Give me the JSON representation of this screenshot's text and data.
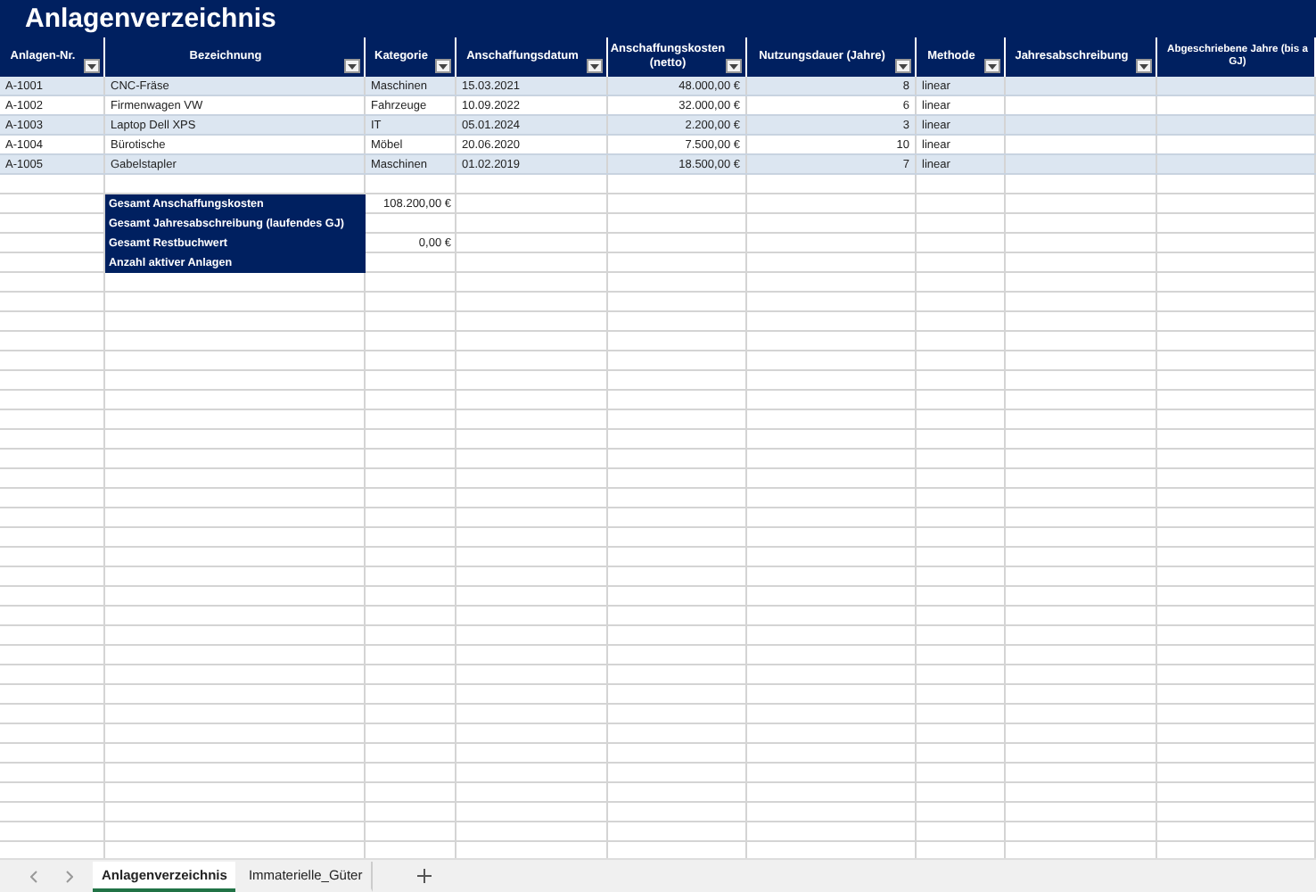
{
  "title": "Anlagenverzeichnis",
  "columns": [
    {
      "label": "Anlagen-Nr.",
      "filter": true
    },
    {
      "label": "Bezeichnung",
      "filter": true
    },
    {
      "label": "Kategorie",
      "filter": true
    },
    {
      "label": "Anschaffungsdatum",
      "filter": true
    },
    {
      "label": "Anschaffungskosten (netto)",
      "filter": true
    },
    {
      "label": "Nutzungsdauer (Jahre)",
      "filter": true
    },
    {
      "label": "Methode",
      "filter": true
    },
    {
      "label": "Jahresabschreibung",
      "filter": true
    },
    {
      "label": "Abgeschriebene Jahre (bis a\nGJ)",
      "filter": false
    }
  ],
  "rows": [
    {
      "id": "A-1001",
      "name": "CNC-Fräse",
      "category": "Maschinen",
      "date": "15.03.2021",
      "cost": "48.000,00 €",
      "life": "8",
      "method": "linear"
    },
    {
      "id": "A-1002",
      "name": "Firmenwagen VW",
      "category": "Fahrzeuge",
      "date": "10.09.2022",
      "cost": "32.000,00 €",
      "life": "6",
      "method": "linear"
    },
    {
      "id": "A-1003",
      "name": "Laptop Dell XPS",
      "category": "IT",
      "date": "05.01.2024",
      "cost": "2.200,00 €",
      "life": "3",
      "method": "linear"
    },
    {
      "id": "A-1004",
      "name": "Bürotische",
      "category": "Möbel",
      "date": "20.06.2020",
      "cost": "7.500,00 €",
      "life": "10",
      "method": "linear"
    },
    {
      "id": "A-1005",
      "name": "Gabelstapler",
      "category": "Maschinen",
      "date": "01.02.2019",
      "cost": "18.500,00 €",
      "life": "7",
      "method": "linear"
    }
  ],
  "summary": [
    {
      "label": "Gesamt Anschaffungskosten",
      "value": "108.200,00 €"
    },
    {
      "label": "Gesamt Jahresabschreibung (laufendes GJ)"
    },
    {
      "label": "Gesamt Restbuchwert",
      "value": "0,00 €"
    },
    {
      "label": "Anzahl aktiver Anlagen"
    }
  ],
  "sheet_tabs": [
    {
      "label": "Anlagenverzeichnis",
      "selected": true
    },
    {
      "label": "Immaterielle_Güter",
      "selected": false
    }
  ]
}
